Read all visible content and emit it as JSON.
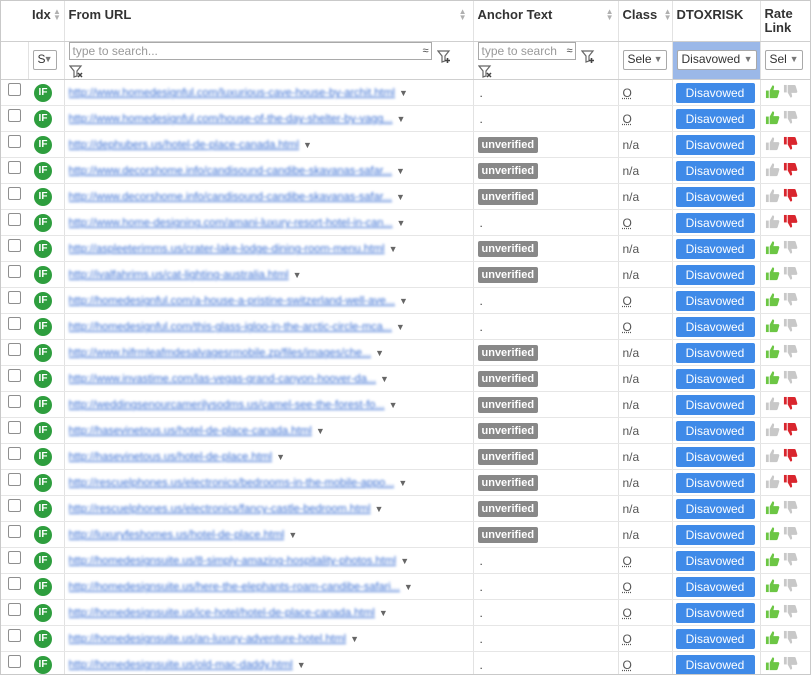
{
  "headers": {
    "idx": "Idx",
    "from_url": "From URL",
    "anchor_text": "Anchor Text",
    "class": "Class",
    "dtoxrisk": "DTOXRISK",
    "rate_link": "Rate Link"
  },
  "filters": {
    "idx_select": "S",
    "url_placeholder": "type to search...",
    "anchor_placeholder": "type to search",
    "approx_symbol": "≈",
    "class_select": "Sele",
    "dtox_select": "Disavowed",
    "rate_select": "Sel"
  },
  "colors": {
    "disavow_button": "#3f8ae8",
    "if_badge": "#2e9e3e",
    "thumb_up_active": "#6cc644",
    "thumb_down_active": "#d9262e",
    "thumb_inactive": "#c8c8c8",
    "unverified_badge": "#888888",
    "dtox_filter_bg": "#9bb8e8"
  },
  "rows": [
    {
      "badge": "IF",
      "url": "http://www.homedesignful.com/luxurious-cave-house-by-archit.html",
      "anchor": ".",
      "cls": "O",
      "action": "Disavowed",
      "rating": "up"
    },
    {
      "badge": "IF",
      "url": "http://www.homedesignful.com/house-of-the-day-shelter-by-vagg...",
      "anchor": ".",
      "cls": "O",
      "action": "Disavowed",
      "rating": "up"
    },
    {
      "badge": "IF",
      "url": "http://dephubers.us/hotel-de-place-canada.html",
      "anchor": "unverified",
      "cls": "n/a",
      "action": "Disavowed",
      "rating": "down"
    },
    {
      "badge": "IF",
      "url": "http://www.decorshome.info/candisound-candibe-skavanas-safar...",
      "anchor": "unverified",
      "cls": "n/a",
      "action": "Disavowed",
      "rating": "down"
    },
    {
      "badge": "IF",
      "url": "http://www.decorshome.info/candisound-candibe-skavanas-safar...",
      "anchor": "unverified",
      "cls": "n/a",
      "action": "Disavowed",
      "rating": "down"
    },
    {
      "badge": "IF",
      "url": "http://www.home-designing.com/amani-luxury-resort-hotel-in-can...",
      "anchor": ".",
      "cls": "O",
      "action": "Disavowed",
      "rating": "down"
    },
    {
      "badge": "IF",
      "url": "http://aspleeterimms.us/crater-lake-lodge-dining-room-menu.html",
      "anchor": "unverified",
      "cls": "n/a",
      "action": "Disavowed",
      "rating": "up"
    },
    {
      "badge": "IF",
      "url": "http://ivalfahrims.us/cat-lighting-australia.html",
      "anchor": "unverified",
      "cls": "n/a",
      "action": "Disavowed",
      "rating": "up"
    },
    {
      "badge": "IF",
      "url": "http://homedesignful.com/a-house-a-pristine-switzerland-well-ave...",
      "anchor": ".",
      "cls": "O",
      "action": "Disavowed",
      "rating": "up"
    },
    {
      "badge": "IF",
      "url": "http://homedesignful.com/this-glass-igloo-in-the-arctic-circle-mca...",
      "anchor": ".",
      "cls": "O",
      "action": "Disavowed",
      "rating": "up"
    },
    {
      "badge": "IF",
      "url": "http://www.hifrmleafmdesalvagesrmobile.zp/files/images/che...",
      "anchor": "unverified",
      "cls": "n/a",
      "action": "Disavowed",
      "rating": "up"
    },
    {
      "badge": "IF",
      "url": "http://www.invastime.com/las-vegas-grand-canyon-hoover-da...",
      "anchor": "unverified",
      "cls": "n/a",
      "action": "Disavowed",
      "rating": "up"
    },
    {
      "badge": "IF",
      "url": "http://weddingsenourcamerilysodms.us/camel-see-the-forest-fo...",
      "anchor": "unverified",
      "cls": "n/a",
      "action": "Disavowed",
      "rating": "down"
    },
    {
      "badge": "IF",
      "url": "http://hasevinetous.us/hotel-de-place-canada.html",
      "anchor": "unverified",
      "cls": "n/a",
      "action": "Disavowed",
      "rating": "down"
    },
    {
      "badge": "IF",
      "url": "http://hasevinetous.us/hotel-de-place.html",
      "anchor": "unverified",
      "cls": "n/a",
      "action": "Disavowed",
      "rating": "down"
    },
    {
      "badge": "IF",
      "url": "http://rescuelphones.us/electronics/bedrooms-in-the-mobile-appo...",
      "anchor": "unverified",
      "cls": "n/a",
      "action": "Disavowed",
      "rating": "down"
    },
    {
      "badge": "IF",
      "url": "http://rescuelphones.us/electronics/fancy-castle-bedroom.html",
      "anchor": "unverified",
      "cls": "n/a",
      "action": "Disavowed",
      "rating": "up"
    },
    {
      "badge": "IF",
      "url": "http://luxuryfeshomes.us/hotel-de-place.html",
      "anchor": "unverified",
      "cls": "n/a",
      "action": "Disavowed",
      "rating": "up"
    },
    {
      "badge": "IF",
      "url": "http://homedesignsuite.us/8-simply-amazing-hospitality-photos.html",
      "anchor": ".",
      "cls": "O",
      "action": "Disavowed",
      "rating": "up"
    },
    {
      "badge": "IF",
      "url": "http://homedesignsuite.us/here-the-elephants-roam-candibe-safari...",
      "anchor": ".",
      "cls": "O",
      "action": "Disavowed",
      "rating": "up"
    },
    {
      "badge": "IF",
      "url": "http://homedesignsuite.us/ice-hotel/hotel-de-place-canada.html",
      "anchor": ".",
      "cls": "O",
      "action": "Disavowed",
      "rating": "up"
    },
    {
      "badge": "IF",
      "url": "http://homedesignsuite.us/an-luxury-adventure-hotel.html",
      "anchor": ".",
      "cls": "O",
      "action": "Disavowed",
      "rating": "up"
    },
    {
      "badge": "IF",
      "url": "http://homedesignsuite.us/old-mac-daddy.html",
      "anchor": ".",
      "cls": "O",
      "action": "Disavowed",
      "rating": "up"
    }
  ]
}
